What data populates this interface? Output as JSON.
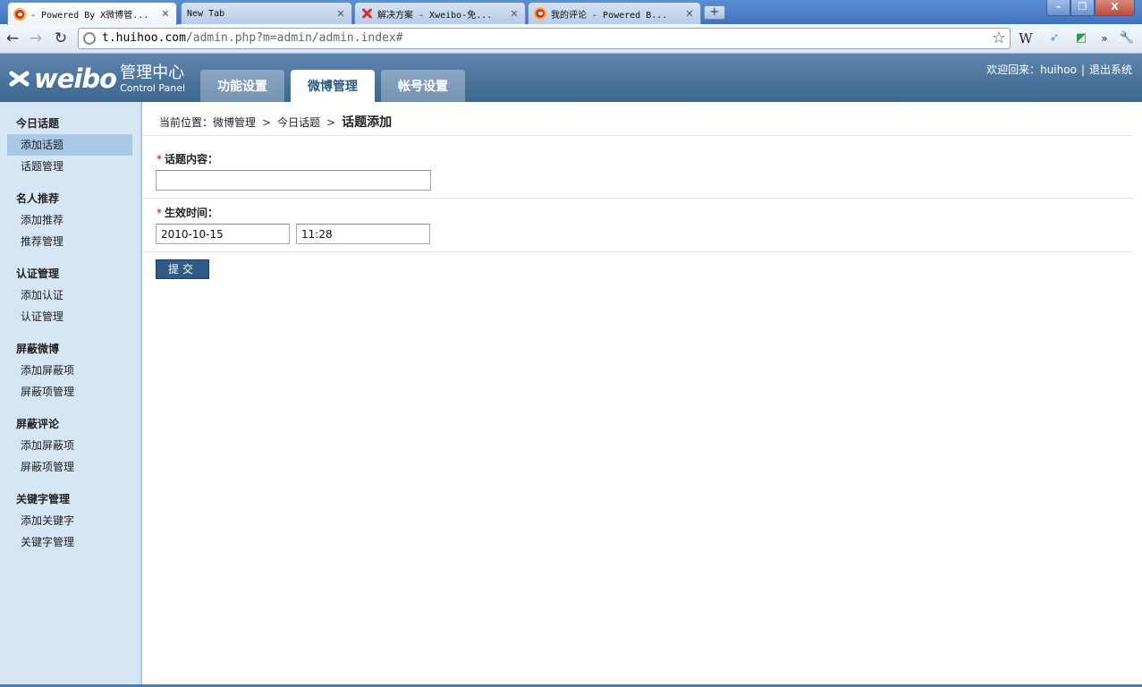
{
  "browser": {
    "tabs": [
      {
        "title": "- Powered By X微博管...",
        "favicon": "weibo-icon"
      },
      {
        "title": "New Tab",
        "favicon": ""
      },
      {
        "title": "解决方案 - Xweibo-免...",
        "favicon": "xweibo-icon"
      },
      {
        "title": "我的评论 - Powered B...",
        "favicon": "weibo-icon"
      }
    ],
    "url_host": "t.huihoo.com",
    "url_path": "/admin.php?m=admin/admin.index#",
    "tool_w": "W"
  },
  "header": {
    "logo_word": "weibo",
    "logo_cn": "管理中心",
    "logo_en": "Control Panel",
    "tabs": [
      "功能设置",
      "微博管理",
      "帐号设置"
    ],
    "active_tab": 1,
    "welcome": "欢迎回来：huihoo",
    "logout": "退出系统",
    "separator": "|"
  },
  "sidebar": {
    "groups": [
      {
        "title": "今日话题",
        "items": [
          "添加话题",
          "话题管理"
        ]
      },
      {
        "title": "名人推荐",
        "items": [
          "添加推荐",
          "推荐管理"
        ]
      },
      {
        "title": "认证管理",
        "items": [
          "添加认证",
          "认证管理"
        ]
      },
      {
        "title": "屏蔽微博",
        "items": [
          "添加屏蔽项",
          "屏蔽项管理"
        ]
      },
      {
        "title": "屏蔽评论",
        "items": [
          "添加屏蔽项",
          "屏蔽项管理"
        ]
      },
      {
        "title": "关键字管理",
        "items": [
          "添加关键字",
          "关键字管理"
        ]
      }
    ],
    "active_item": "添加话题"
  },
  "main": {
    "breadcrumb": {
      "prefix": "当前位置：微博管理",
      "arrow": ">",
      "middle": "今日话题",
      "current": "话题添加"
    },
    "topic_label": "话题内容：",
    "topic_value": "",
    "time_label": "生效时间：",
    "date_value": "2010-10-15",
    "time_value": "11:28",
    "required_mark": "*",
    "submit_label": "提交"
  }
}
